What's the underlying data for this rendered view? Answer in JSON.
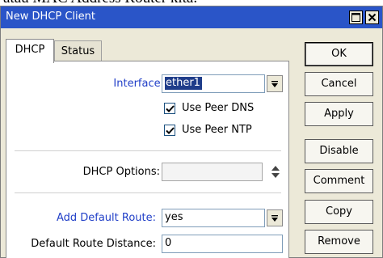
{
  "background_caption": "atau MAC Address Router kita.",
  "window": {
    "title": "New DHCP Client"
  },
  "tabs": [
    {
      "label": "DHCP",
      "active": true
    },
    {
      "label": "Status",
      "active": false
    }
  ],
  "form": {
    "interface_label": "Interface:",
    "interface_value": "ether1",
    "use_peer_dns_label": "Use Peer DNS",
    "use_peer_dns_checked": true,
    "use_peer_ntp_label": "Use Peer NTP",
    "use_peer_ntp_checked": true,
    "dhcp_options_label": "DHCP Options:",
    "dhcp_options_value": "",
    "add_default_route_label": "Add Default Route:",
    "add_default_route_value": "yes",
    "default_route_distance_label": "Default Route Distance:",
    "default_route_distance_value": "0"
  },
  "buttons": {
    "ok": "OK",
    "cancel": "Cancel",
    "apply": "Apply",
    "disable": "Disable",
    "comment": "Comment",
    "copy": "Copy",
    "remove": "Remove"
  },
  "colors": {
    "titlebar": "#2a55c8",
    "label_blue": "#2240c8",
    "window_bg": "#ece9d8",
    "selection": "#1f3d8a"
  },
  "icons": {
    "maximize": "maximize-icon",
    "close": "close-icon",
    "dropdown": "dropdown-arrow-icon",
    "checkmark": "checkmark-icon",
    "updown": "up-down-arrows-icon"
  }
}
